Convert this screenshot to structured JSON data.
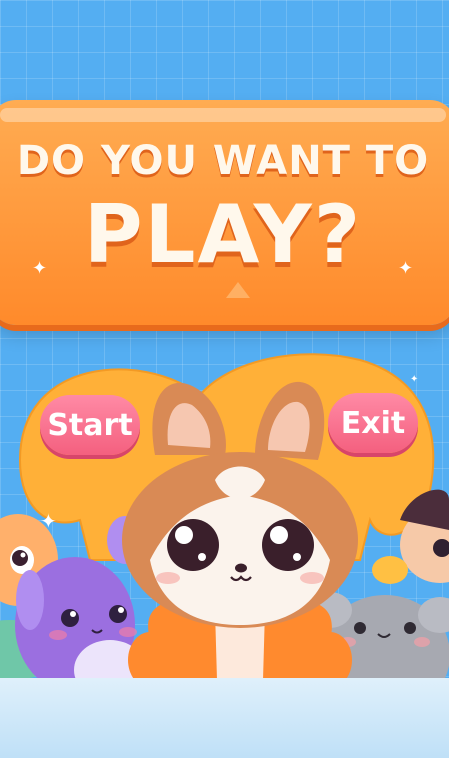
{
  "banner": {
    "line1": "DO YOU WANT TO",
    "line2": "PLAY?"
  },
  "buttons": {
    "start_label": "Start",
    "exit_label": "Exit"
  },
  "colors": {
    "background": "#54aef2",
    "banner": "#ff9a3c",
    "button": "#f4607f",
    "fox": "#d98a55",
    "purple_creature": "#9b6fe0",
    "gray_creature": "#a7a9b1"
  }
}
